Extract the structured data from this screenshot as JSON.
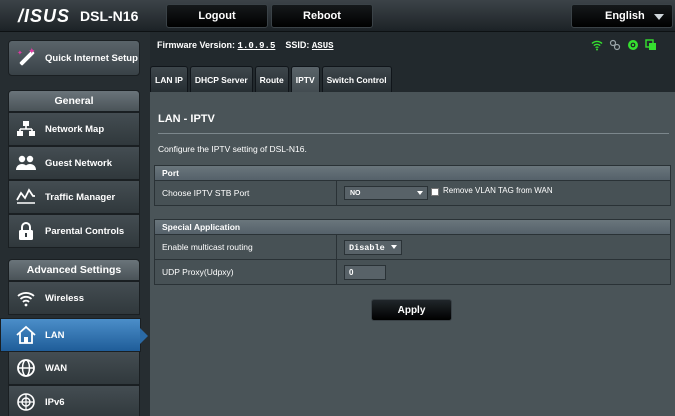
{
  "header": {
    "brand": "/ISUS",
    "model": "DSL-N16",
    "logout_label": "Logout",
    "reboot_label": "Reboot",
    "language": "English"
  },
  "sidebar": {
    "quick_setup": "Quick Internet Setup",
    "general_title": "General",
    "general_items": [
      {
        "label": "Network Map",
        "icon": "network-map-icon"
      },
      {
        "label": "Guest Network",
        "icon": "guest-network-icon"
      },
      {
        "label": "Traffic Manager",
        "icon": "traffic-manager-icon"
      },
      {
        "label": "Parental Controls",
        "icon": "parental-controls-icon"
      }
    ],
    "advanced_title": "Advanced Settings",
    "advanced_items": [
      {
        "label": "Wireless",
        "icon": "wireless-icon"
      },
      {
        "label": "LAN",
        "icon": "lan-icon",
        "active": true
      },
      {
        "label": "WAN",
        "icon": "wan-icon"
      },
      {
        "label": "IPv6",
        "icon": "ipv6-icon"
      }
    ]
  },
  "status": {
    "firmware_label": "Firmware Version:",
    "firmware_value": "1.0.9.5",
    "ssid_label": "SSID:",
    "ssid_value": "ASUS",
    "icons": [
      "wifi-icon",
      "usb-icon",
      "internet-globe-icon",
      "copy-icon"
    ]
  },
  "tabs": [
    {
      "label": "LAN IP"
    },
    {
      "label": "DHCP Server"
    },
    {
      "label": "Route"
    },
    {
      "label": "IPTV",
      "active": true
    },
    {
      "label": "Switch Control"
    }
  ],
  "page": {
    "title": "LAN - IPTV",
    "description": "Configure the IPTV setting of DSL-N16."
  },
  "port_section": {
    "title": "Port",
    "stb_label": "Choose IPTV STB Port",
    "stb_value": "NO",
    "remove_vlan_label": "Remove VLAN TAG from WAN"
  },
  "special_section": {
    "title": "Special Application",
    "multicast_label": "Enable multicast routing",
    "multicast_value": "Disable",
    "udp_label": "UDP Proxy(Udpxy)",
    "udp_value": "0"
  },
  "apply_label": "Apply",
  "colors": {
    "active_nav": "#2a6aa6",
    "status_green": "#35e02f",
    "accent_pink": "#e03aa4"
  }
}
